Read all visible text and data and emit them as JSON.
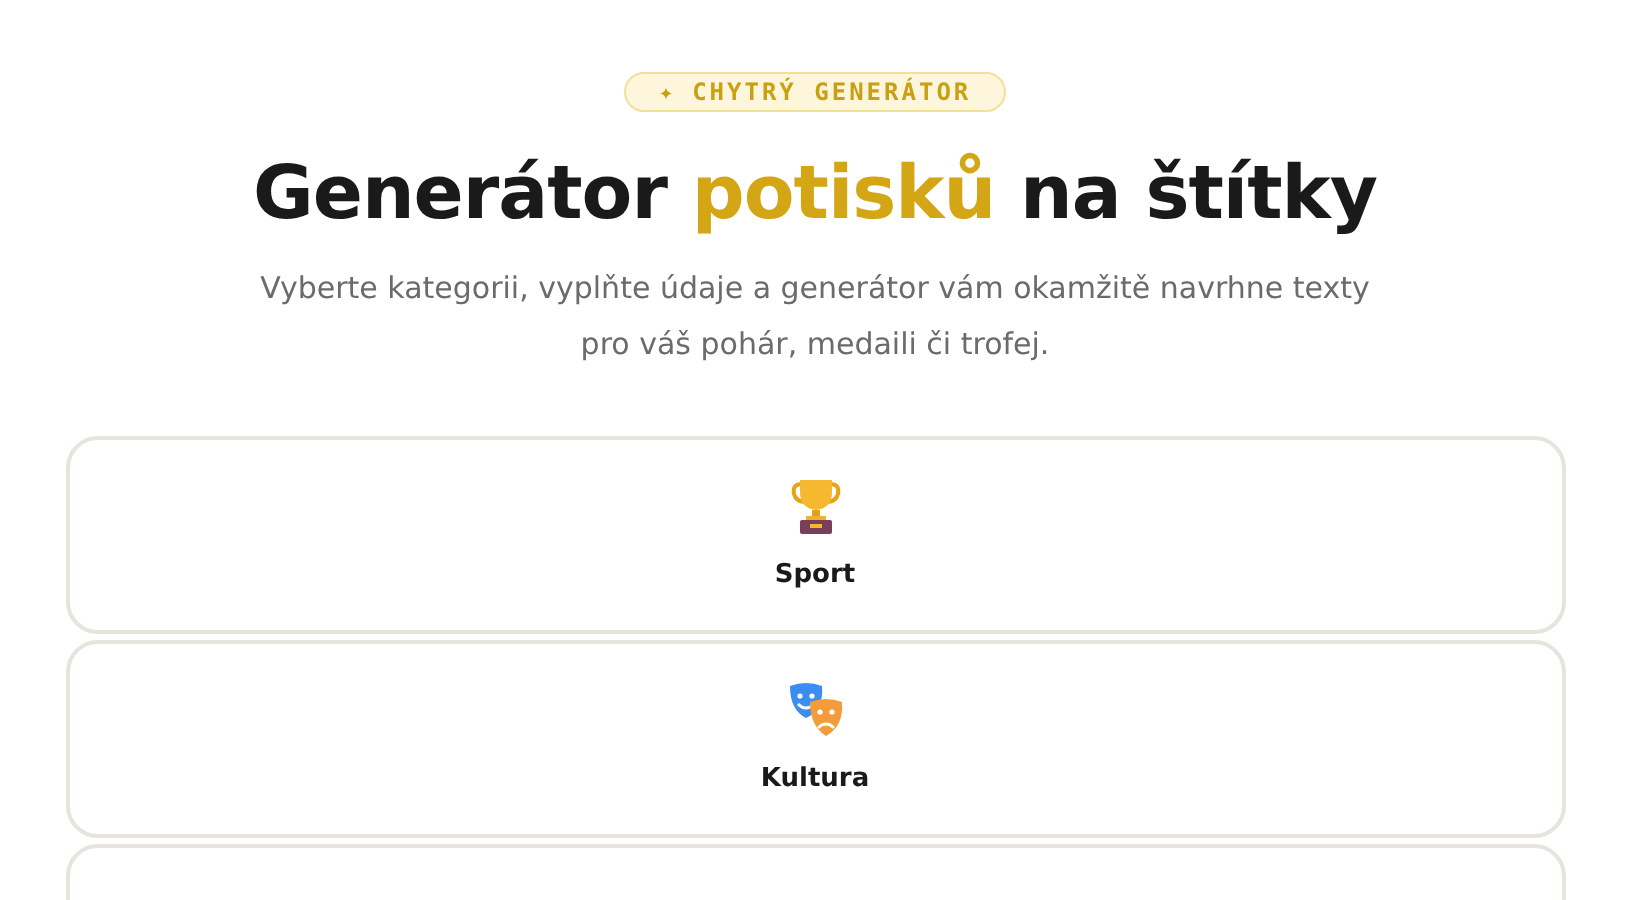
{
  "badge": {
    "icon": "✦",
    "label": "CHYTRÝ GENERÁTOR"
  },
  "heading": {
    "before": "Generátor",
    "highlight": "potisků",
    "after": "na štítky"
  },
  "subtitle": "Vyberte kategorii, vyplňte údaje a generátor vám okamžitě navrhne texty pro váš pohár, medaili či trofej.",
  "categories": [
    {
      "kind": "trophy",
      "label": "Sport"
    },
    {
      "kind": "masks",
      "label": "Kultura"
    }
  ]
}
